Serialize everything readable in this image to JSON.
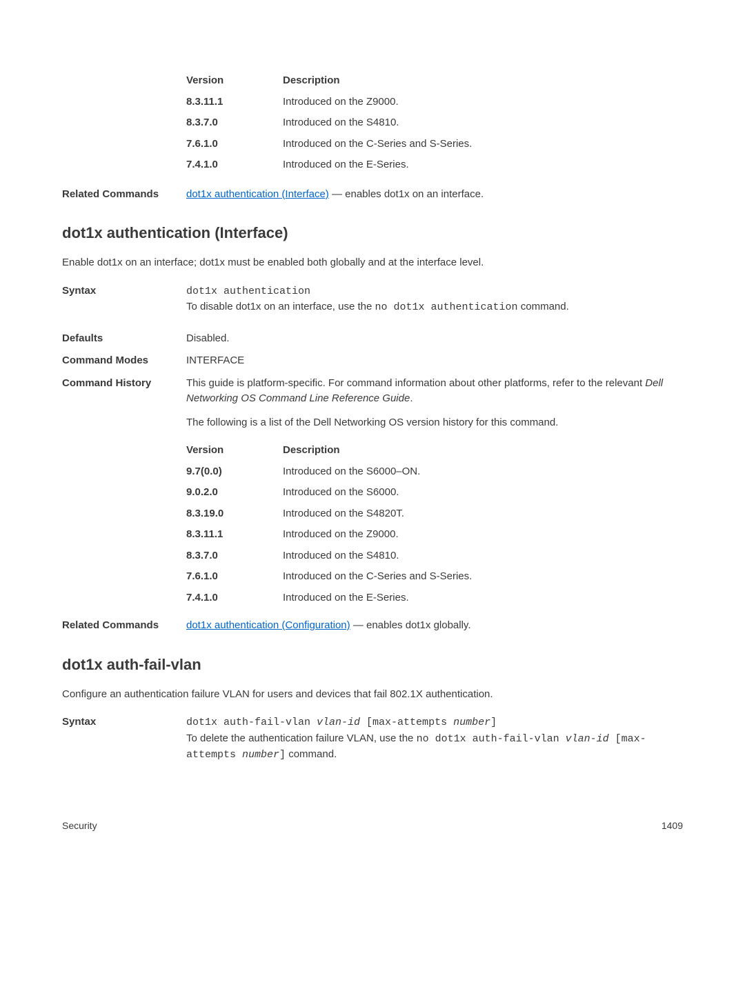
{
  "top_table": {
    "header": {
      "col1": "Version",
      "col2": "Description"
    },
    "rows": [
      {
        "version": "8.3.11.1",
        "desc": "Introduced on the Z9000."
      },
      {
        "version": "8.3.7.0",
        "desc": "Introduced on the S4810."
      },
      {
        "version": "7.6.1.0",
        "desc": "Introduced on the C-Series and S-Series."
      },
      {
        "version": "7.4.1.0",
        "desc": "Introduced on the E-Series."
      }
    ]
  },
  "related1": {
    "label": "Related Commands",
    "link": "dot1x authentication (Interface)",
    "after": " — enables dot1x on an interface."
  },
  "section1": {
    "title": "dot1x authentication (Interface)",
    "intro": "Enable dot1x on an interface; dot1x must be enabled both globally and at the interface level.",
    "syntax": {
      "label": "Syntax",
      "code": "dot1x authentication",
      "line2_a": "To disable dot1x on an interface, use the ",
      "line2_code": "no dot1x authentication",
      "line2_b": " command."
    },
    "defaults": {
      "label": "Defaults",
      "value": "Disabled."
    },
    "command_modes": {
      "label": "Command Modes",
      "value": "INTERFACE"
    },
    "command_history": {
      "label": "Command History",
      "p1_a": "This guide is platform-specific. For command information about other platforms, refer to the relevant ",
      "p1_italic": "Dell Networking OS Command Line Reference Guide",
      "p1_b": ".",
      "p2": "The following is a list of the Dell Networking OS version history for this command."
    },
    "history_table": {
      "header": {
        "col1": "Version",
        "col2": "Description"
      },
      "rows": [
        {
          "version": "9.7(0.0)",
          "desc": "Introduced on the S6000–ON."
        },
        {
          "version": "9.0.2.0",
          "desc": "Introduced on the S6000."
        },
        {
          "version": "8.3.19.0",
          "desc": "Introduced on the S4820T."
        },
        {
          "version": "8.3.11.1",
          "desc": "Introduced on the Z9000."
        },
        {
          "version": "8.3.7.0",
          "desc": "Introduced on the S4810."
        },
        {
          "version": "7.6.1.0",
          "desc": "Introduced on the C-Series and S-Series."
        },
        {
          "version": "7.4.1.0",
          "desc": "Introduced on the E-Series."
        }
      ]
    },
    "related": {
      "label": "Related Commands",
      "link": "dot1x authentication (Configuration)",
      "after": " — enables dot1x globally."
    }
  },
  "section2": {
    "title": "dot1x auth-fail-vlan",
    "intro": "Configure an authentication failure VLAN for users and devices that fail 802.1X authentication.",
    "syntax": {
      "label": "Syntax",
      "code_a": "dot1x auth-fail-vlan ",
      "code_i1": "vlan-id",
      "code_b": " [max-attempts ",
      "code_i2": "number",
      "code_c": "]",
      "line2_a": "To delete the authentication failure VLAN, use the ",
      "line2_code": "no dot1x auth-fail-vlan ",
      "line2_i1": "vlan-id",
      "line2_mid": " [max-attempts ",
      "line2_i2": "number",
      "line2_end": "]",
      "line2_after": " command."
    }
  },
  "footer": {
    "left": "Security",
    "right": "1409"
  }
}
